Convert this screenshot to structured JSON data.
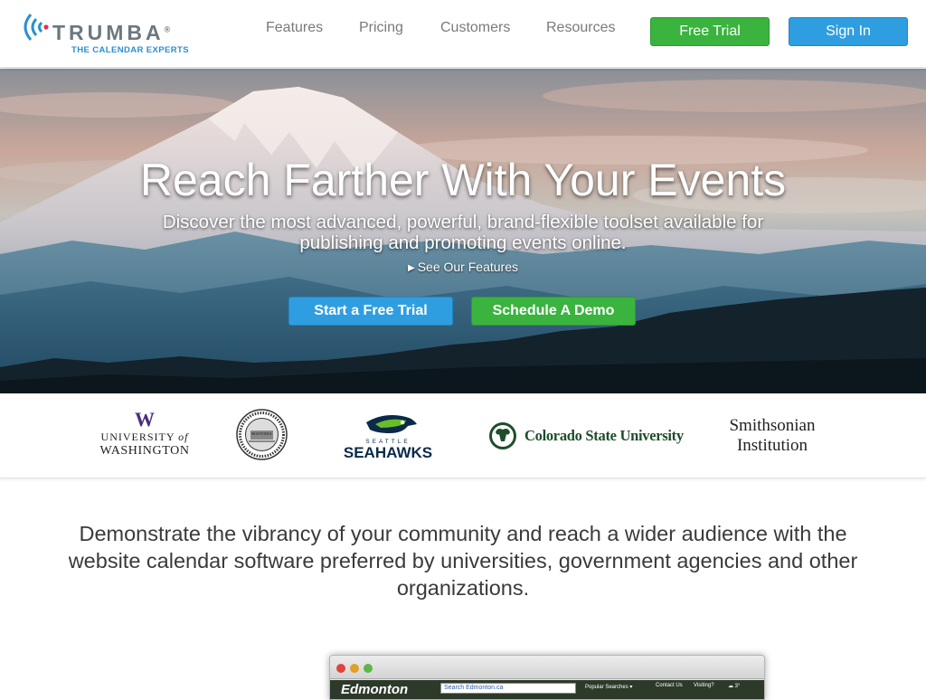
{
  "header": {
    "logo_word": "TRUMBA",
    "logo_reg": "®",
    "logo_tagline": "THE CALENDAR EXPERTS",
    "nav": [
      "Features",
      "Pricing",
      "Customers",
      "Resources"
    ],
    "free_trial_label": "Free Trial",
    "sign_in_label": "Sign In"
  },
  "hero": {
    "title": "Reach Farther With Your Events",
    "subtitle": "Discover the most advanced, powerful, brand-flexible toolset available for publishing and promoting events online.",
    "features_link": "See Our Features",
    "start_trial_label": "Start a Free Trial",
    "schedule_demo_label": "Schedule A Demo"
  },
  "customers": {
    "uw_mark": "W",
    "uw_line1": "UNIVERSITY",
    "uw_of": "of",
    "uw_line2": "WASHINGTON",
    "seal_text": "BOSTONIA",
    "seahawks_small": "SEATTLE",
    "seahawks_big": "SEAHAWKS",
    "csu_name": "Colorado State University",
    "smithsonian_line1": "Smithsonian",
    "smithsonian_line2": "Institution"
  },
  "pitch": "Demonstrate the vibrancy of your community and reach a wider audience with the website calendar software preferred by universities, government agencies and other organizations.",
  "preview": {
    "site_logo": "Edmonton",
    "search_placeholder": "Search Edmonton.ca",
    "popular": "Popular Searches ▾",
    "contact": "Contact Us",
    "visiting": "Visiting?",
    "weather": "☁ 3°"
  },
  "colors": {
    "green": "#3bb33f",
    "blue": "#2f9ee0",
    "logo_gray": "#6b7880",
    "logo_blue": "#2b8fd1"
  }
}
